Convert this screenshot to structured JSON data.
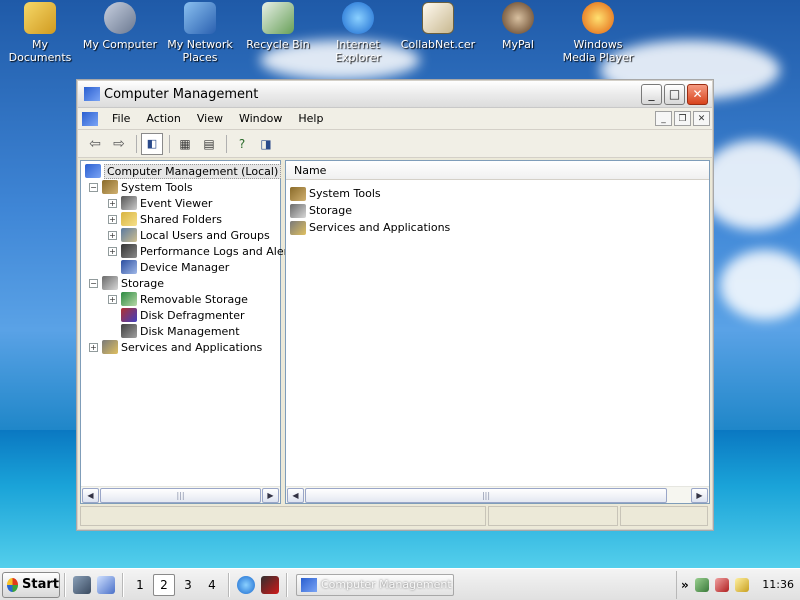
{
  "desktop": {
    "icons": [
      {
        "label": "My Documents",
        "icon": "my-documents-icon",
        "color": "#f0c040"
      },
      {
        "label": "My Computer",
        "icon": "my-computer-icon",
        "color": "#9aa8c0"
      },
      {
        "label": "My Network Places",
        "icon": "network-places-icon",
        "color": "#4a8ad8"
      },
      {
        "label": "Recycle Bin",
        "icon": "recycle-bin-icon",
        "color": "#78b868"
      },
      {
        "label": "Internet Explorer",
        "icon": "internet-explorer-icon",
        "color": "#2a8ae0"
      },
      {
        "label": "CollabNet.cer",
        "icon": "certificate-icon",
        "color": "#e8e0c0"
      },
      {
        "label": "MyPal",
        "icon": "mypal-icon",
        "color": "#8a6a40"
      },
      {
        "label": "Windows Media Player",
        "icon": "media-player-icon",
        "color": "#f08a20"
      }
    ]
  },
  "window": {
    "title": "Computer Management",
    "menu": [
      "File",
      "Action",
      "View",
      "Window",
      "Help"
    ]
  },
  "tree": {
    "root": "Computer Management (Local)",
    "system_tools": "System Tools",
    "event_viewer": "Event Viewer",
    "shared_folders": "Shared Folders",
    "local_users": "Local Users and Groups",
    "perf_logs": "Performance Logs and Alert:",
    "device_manager": "Device Manager",
    "storage": "Storage",
    "removable_storage": "Removable Storage",
    "disk_defrag": "Disk Defragmenter",
    "disk_management": "Disk Management",
    "services_apps": "Services and Applications"
  },
  "list": {
    "column": "Name",
    "items": [
      "System Tools",
      "Storage",
      "Services and Applications"
    ]
  },
  "taskbar": {
    "start": "Start",
    "workspaces": [
      "1",
      "2",
      "3",
      "4"
    ],
    "task": "Computer Management",
    "clock": "11:36"
  }
}
